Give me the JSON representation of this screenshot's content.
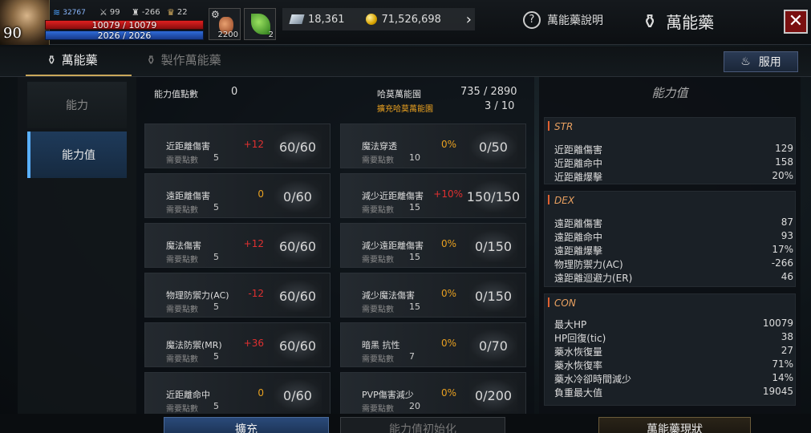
{
  "player": {
    "level": "90",
    "power": "32767",
    "stat_a": "99",
    "stat_b": "-266",
    "stat_c": "22",
    "hp": "10079 / 10079",
    "mp": "2026 / 2026"
  },
  "slots": [
    {
      "count": "2200"
    },
    {
      "count": "2"
    }
  ],
  "currency": {
    "gems": "18,361",
    "gold": "71,526,698"
  },
  "header": {
    "help_label": "萬能藥說明",
    "title": "萬能藥",
    "close": "✕"
  },
  "tabs": [
    {
      "label": "萬能藥"
    },
    {
      "label": "製作萬能藥"
    }
  ],
  "use_button": "服用",
  "sidebar": [
    {
      "label": "能力"
    },
    {
      "label": "能力值"
    }
  ],
  "points": {
    "label": "能力值點數",
    "value": "0",
    "harvest_label": "哈莫萬能園",
    "harvest_value": "735 / 2890",
    "expand_label": "擴充哈莫萬能園",
    "expand_value": "3 / 10"
  },
  "req_label": "需要點數",
  "left_cards": [
    {
      "name": "近距離傷害",
      "bonus": "+12",
      "level": "60/60",
      "req": "5"
    },
    {
      "name": "遠距離傷害",
      "bonus": "0",
      "level": "0/60",
      "req": "5"
    },
    {
      "name": "魔法傷害",
      "bonus": "+12",
      "level": "60/60",
      "req": "5"
    },
    {
      "name": "物理防禦力(AC)",
      "bonus": "-12",
      "level": "60/60",
      "req": "5"
    },
    {
      "name": "魔法防禦(MR)",
      "bonus": "+36",
      "level": "60/60",
      "req": "5"
    },
    {
      "name": "近距離命中",
      "bonus": "0",
      "level": "0/60",
      "req": "5"
    }
  ],
  "right_cards": [
    {
      "name": "魔法穿透",
      "bonus": "0%",
      "level": "0/50",
      "req": "10"
    },
    {
      "name": "減少近距離傷害",
      "bonus": "+10%",
      "level": "150/150",
      "req": "15"
    },
    {
      "name": "減少遠距離傷害",
      "bonus": "0%",
      "level": "0/150",
      "req": "15"
    },
    {
      "name": "減少魔法傷害",
      "bonus": "0%",
      "level": "0/150",
      "req": "15"
    },
    {
      "name": "暗黑 抗性",
      "bonus": "0%",
      "level": "0/70",
      "req": "7"
    },
    {
      "name": "PVP傷害減少",
      "bonus": "0%",
      "level": "0/200",
      "req": "20"
    }
  ],
  "stats_panel": {
    "title": "能力值",
    "sections": [
      {
        "head": "STR",
        "rows": [
          {
            "k": "近距離傷害",
            "v": "129"
          },
          {
            "k": "近距離命中",
            "v": "158"
          },
          {
            "k": "近距離爆擊",
            "v": "20%"
          }
        ]
      },
      {
        "head": "DEX",
        "rows": [
          {
            "k": "遠距離傷害",
            "v": "87"
          },
          {
            "k": "遠距離命中",
            "v": "93"
          },
          {
            "k": "遠距離爆擊",
            "v": "17%"
          },
          {
            "k": "物理防禦力(AC)",
            "v": "-266"
          },
          {
            "k": "遠距離迴避力(ER)",
            "v": "46"
          }
        ]
      },
      {
        "head": "CON",
        "rows": [
          {
            "k": "最大HP",
            "v": "10079"
          },
          {
            "k": "HP回復(tic)",
            "v": "38"
          },
          {
            "k": "藥水恢復量",
            "v": "27"
          },
          {
            "k": "藥水恢復率",
            "v": "71%"
          },
          {
            "k": "藥水冷卻時間減少",
            "v": "14%"
          },
          {
            "k": "負重最大值",
            "v": "19045"
          }
        ]
      }
    ]
  },
  "bottom_buttons": [
    {
      "label": "擴充"
    },
    {
      "label": "能力值初始化"
    },
    {
      "label": "萬能藥現狀"
    }
  ]
}
